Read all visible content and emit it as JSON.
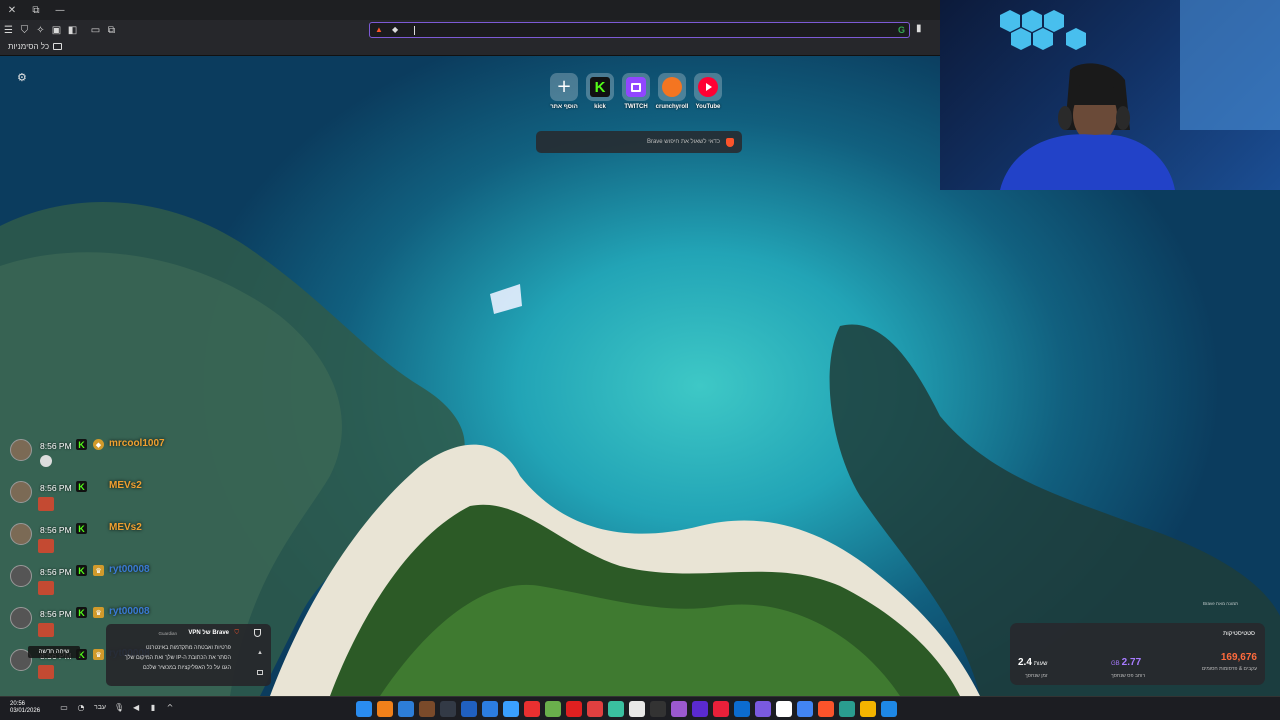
{
  "window": {
    "close": "✕",
    "restore": "⧉",
    "minimize": "—"
  },
  "browser": {
    "toolbar_icons": [
      "menu-icon",
      "shield-icon",
      "rewards-icon",
      "wallet-icon",
      "sidebar-icon",
      "screenshot-icon",
      "extensions-icon"
    ],
    "bookmarks_all_label": "כל הסימניות"
  },
  "new_tab": {
    "top_sites": [
      {
        "label": "הוסף אתר",
        "icon": "plus-icon"
      },
      {
        "label": "kick",
        "icon": "kick-icon"
      },
      {
        "label": "TWITCH",
        "icon": "twitch-icon"
      },
      {
        "label": "crunchyroll",
        "icon": "crunchyroll-icon"
      },
      {
        "label": "YouTube",
        "icon": "youtube-icon"
      }
    ],
    "search_placeholder": "כדאי לשאול את חיפוש Brave",
    "photo_credit": "תמונה מאת Brave"
  },
  "chat": {
    "messages": [
      {
        "time": "8:56 PM",
        "user": "mrcool1007",
        "color": "#f0a030",
        "badge": "sub"
      },
      {
        "time": "8:56 PM",
        "user": "MEVs2",
        "color": "#f0a030",
        "badge": "none"
      },
      {
        "time": "8:56 PM",
        "user": "MEVs2",
        "color": "#f0a030",
        "badge": "none"
      },
      {
        "time": "8:56 PM",
        "user": "ryt00008",
        "color": "#3a7bd5",
        "badge": "crown"
      },
      {
        "time": "8:56 PM",
        "user": "ryt00008",
        "color": "#3a7bd5",
        "badge": "crown"
      },
      {
        "time": "8:56 PM",
        "user": "ryt00008",
        "color": "#3a7bd5",
        "badge": "crown"
      }
    ],
    "tooltip": "שיחה חדשה"
  },
  "vpn": {
    "title": "Brave של VPN",
    "subtitle": "Guardian",
    "lines": [
      "פרטיות ואבטחה מתקדמות באינטרנט",
      "הסתר את הכתובת ה-IP שלך ואת המיקום שלך",
      "הגנו על כל האפליקציות במכשיר שלכם"
    ]
  },
  "stats": {
    "heading": "סטטיסטיקות",
    "trackers": {
      "value": "169,676",
      "caption": "עקבים & פרסומות חסומים"
    },
    "bandwidth": {
      "value": "2.77",
      "unit": "GB",
      "caption": "רוחב פס שנחסך"
    },
    "time": {
      "value": "2.4",
      "unit": "שעות",
      "caption": "זמן שנחסך"
    }
  },
  "taskbar": {
    "time": "20:56",
    "date": "03/01/2026",
    "lang": "עבר",
    "apps": [
      "#2a8cf0",
      "#f0801a",
      "#2d7ed8",
      "#7a4a2a",
      "#333a46",
      "#2060c0",
      "#2c7de0",
      "#3aa0ff",
      "#ea3030",
      "#6ab04c",
      "#e02020",
      "#e04040",
      "#3ac0a0",
      "#e8e8e8",
      "#333",
      "#9b59d0",
      "#5a2ad0",
      "#e8203a",
      "#0c6cd0",
      "#7a5ae0",
      "#ffffff",
      "#4285f4",
      "#fb542b",
      "#2a9d8f",
      "#f4b400",
      "#1e88e5"
    ]
  }
}
